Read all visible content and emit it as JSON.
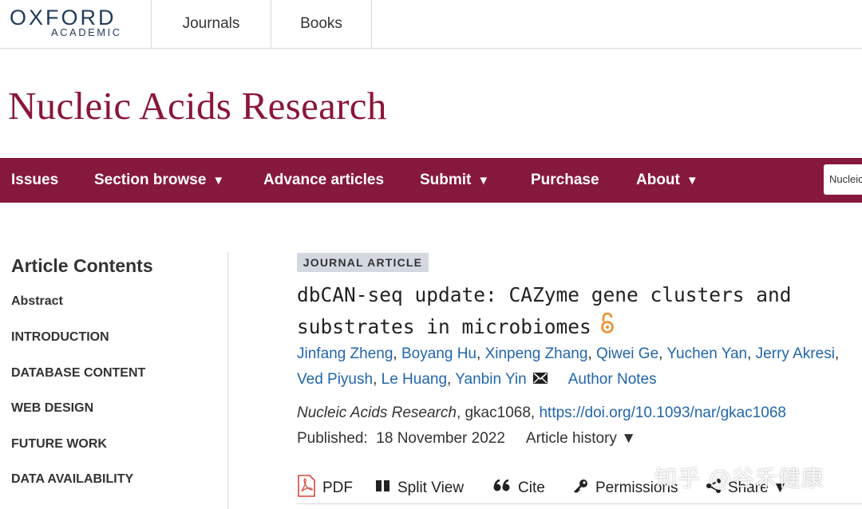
{
  "brand": {
    "line1": "OXFORD",
    "line2": "ACADEMIC"
  },
  "topnav": {
    "journals": "Journals",
    "books": "Books"
  },
  "journal_title": "Nucleic Acids Research",
  "mainnav": {
    "issues": "Issues",
    "section_browse": "Section browse",
    "advance_articles": "Advance articles",
    "submit": "Submit",
    "purchase": "Purchase",
    "about": "About",
    "arrow": "▼",
    "search_text": "Nucleic"
  },
  "sidebar": {
    "title": "Article Contents",
    "items": [
      "Abstract",
      "INTRODUCTION",
      "DATABASE CONTENT",
      "WEB DESIGN",
      "FUTURE WORK",
      "DATA AVAILABILITY"
    ]
  },
  "article": {
    "type_badge": "JOURNAL ARTICLE",
    "title_line1": "dbCAN-seq update: CAZyme gene clusters and",
    "title_line2": "substrates in microbiomes",
    "authors": [
      "Jinfang Zheng",
      "Boyang Hu",
      "Xinpeng Zhang",
      "Qiwei Ge",
      "Yuchen Yan",
      "Jerry Akresi",
      "Ved Piyush",
      "Le Huang",
      "Yanbin Yin"
    ],
    "author_sep": ", ",
    "author_notes": "Author Notes",
    "journal_name": "Nucleic Acids Research",
    "article_id": ", gkac1068, ",
    "doi": "https://doi.org/10.1093/nar/gkac1068",
    "published_label": "Published:",
    "published_date": "18 November 2022",
    "article_history": "Article history ▼"
  },
  "toolbar": {
    "pdf": "PDF",
    "split_view": "Split View",
    "cite": "Cite",
    "permissions": "Permissions",
    "share": "Share ▼"
  },
  "watermark": "知乎 @谷禾健康",
  "colors": {
    "brand": "#87183d",
    "link": "#2166ac",
    "badge": "#d4d9e1"
  },
  "icons": [
    "open-access-icon",
    "mail-icon",
    "pdf-icon",
    "split-view-icon",
    "quote-icon",
    "key-icon",
    "share-icon"
  ]
}
